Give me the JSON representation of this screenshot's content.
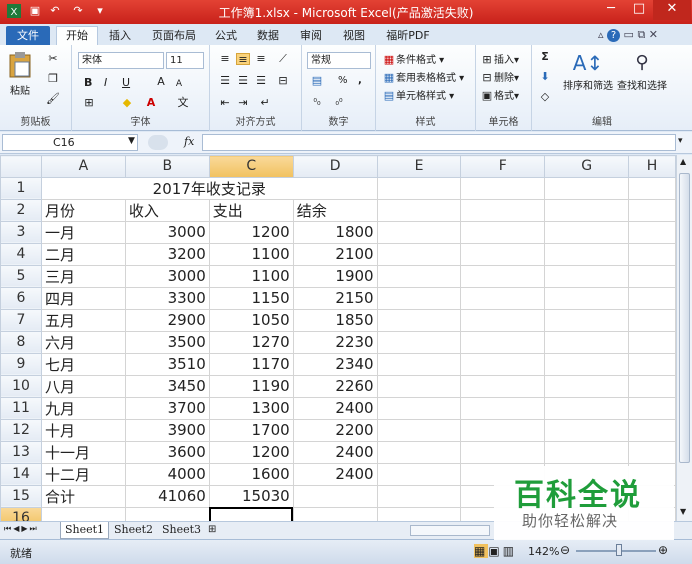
{
  "window": {
    "title": "工作簿1.xlsx - Microsoft Excel(产品激活失败)",
    "controls": [
      "─",
      "□",
      "✕"
    ]
  },
  "ribbon": {
    "file_tab": "文件",
    "tabs": [
      "开始",
      "插入",
      "页面布局",
      "公式",
      "数据",
      "审阅",
      "视图",
      "福昕PDF"
    ],
    "clipboard": {
      "paste": "粘贴",
      "label": "剪贴板"
    },
    "font": {
      "name": "宋体",
      "size": "11",
      "label": "字体",
      "bold": "B",
      "italic": "I",
      "underline": "U"
    },
    "alignment": {
      "label": "对齐方式"
    },
    "number": {
      "format": "常规",
      "percent": "%",
      "comma": ",",
      "label": "数字"
    },
    "styles": {
      "conditional": "条件格式",
      "table": "套用表格格式",
      "cell": "单元格样式",
      "label": "样式"
    },
    "cells": {
      "insert": "插入",
      "delete": "删除",
      "format": "格式",
      "label": "单元格"
    },
    "editing": {
      "sort": "排序和筛选",
      "find": "查找和选择",
      "label": "编辑"
    }
  },
  "formula_bar": {
    "name_box": "C16",
    "fx": "fx",
    "value": ""
  },
  "sheet": {
    "columns": [
      "A",
      "B",
      "C",
      "D",
      "E",
      "F",
      "G",
      "H"
    ],
    "selected_col": "C",
    "selected_row": "16",
    "title": "2017年收支记录",
    "headers": [
      "月份",
      "收入",
      "支出",
      "结余"
    ],
    "rows": [
      [
        "一月",
        "3000",
        "1200",
        "1800"
      ],
      [
        "二月",
        "3200",
        "1100",
        "2100"
      ],
      [
        "三月",
        "3000",
        "1100",
        "1900"
      ],
      [
        "四月",
        "3300",
        "1150",
        "2150"
      ],
      [
        "五月",
        "2900",
        "1050",
        "1850"
      ],
      [
        "六月",
        "3500",
        "1270",
        "2230"
      ],
      [
        "七月",
        "3510",
        "1170",
        "2340"
      ],
      [
        "八月",
        "3450",
        "1190",
        "2260"
      ],
      [
        "九月",
        "3700",
        "1300",
        "2400"
      ],
      [
        "十月",
        "3900",
        "1700",
        "2200"
      ],
      [
        "十一月",
        "3600",
        "1200",
        "2400"
      ],
      [
        "十二月",
        "4000",
        "1600",
        "2400"
      ]
    ],
    "total": [
      "合计",
      "41060",
      "15030",
      ""
    ]
  },
  "sheet_tabs": [
    "Sheet1",
    "Sheet2",
    "Sheet3"
  ],
  "status": {
    "ready": "就绪",
    "zoom": "142%"
  },
  "watermark": {
    "title": "百科全说",
    "subtitle": "助你轻松解决"
  },
  "colors": {
    "titlebar": "#d8322a",
    "accent": "#2a6ab8",
    "selected_header": "#f1c15f",
    "watermark_green": "#1f9d3a"
  }
}
